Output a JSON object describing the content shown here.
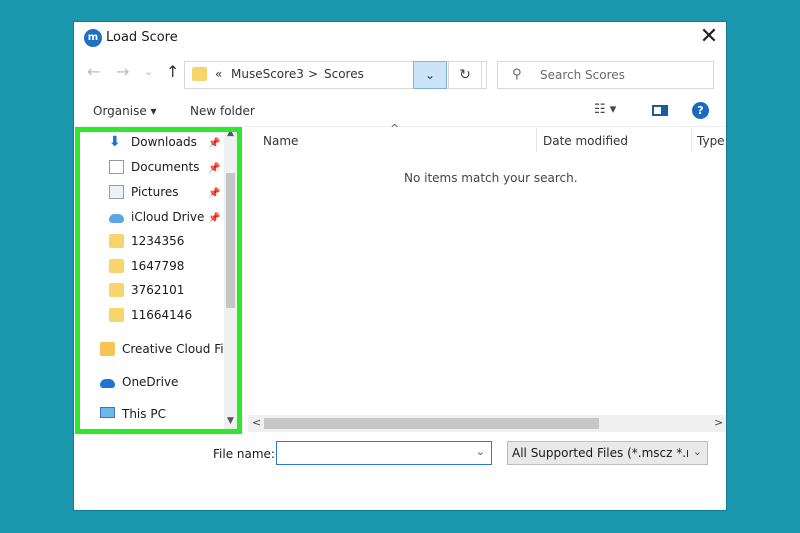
{
  "window": {
    "title": "Load Score",
    "app_icon": "musescore-icon"
  },
  "navigation": {
    "back": "←",
    "forward": "→",
    "recent": "⌄",
    "up": "↑",
    "breadcrumb_prefix": "«",
    "path": [
      "MuseScore3",
      "Scores"
    ],
    "separator": ">",
    "refresh": "↻",
    "dropdown": "⌄"
  },
  "search": {
    "placeholder": "Search Scores"
  },
  "commands": {
    "organise": "Organise ▾",
    "new_folder": "New folder",
    "help": "?"
  },
  "sidebar": {
    "items": [
      {
        "label": "Downloads",
        "icon": "download-icon",
        "pinned": true
      },
      {
        "label": "Documents",
        "icon": "documents-icon",
        "pinned": true
      },
      {
        "label": "Pictures",
        "icon": "pictures-icon",
        "pinned": true
      },
      {
        "label": "iCloud Drive",
        "icon": "icloud-icon",
        "pinned": true
      },
      {
        "label": "1234356",
        "icon": "folder-icon"
      },
      {
        "label": "1647798",
        "icon": "folder-icon"
      },
      {
        "label": "3762101",
        "icon": "folder-icon"
      },
      {
        "label": "11664146",
        "icon": "folder-icon"
      },
      {
        "label": "Creative Cloud Fil",
        "icon": "creative-cloud-icon"
      },
      {
        "label": "OneDrive",
        "icon": "onedrive-icon"
      },
      {
        "label": "This PC",
        "icon": "pc-icon"
      }
    ]
  },
  "content": {
    "columns": [
      "Name",
      "Date modified",
      "Type"
    ],
    "empty_message": "No items match your search."
  },
  "bottom": {
    "file_name_label": "File name:",
    "file_name_value": "",
    "file_type": "All Supported Files (*.mscz *.ms"
  },
  "colors": {
    "highlight": "#2ee82e",
    "background": "#1b97ad",
    "accent": "#2a7ad0"
  }
}
